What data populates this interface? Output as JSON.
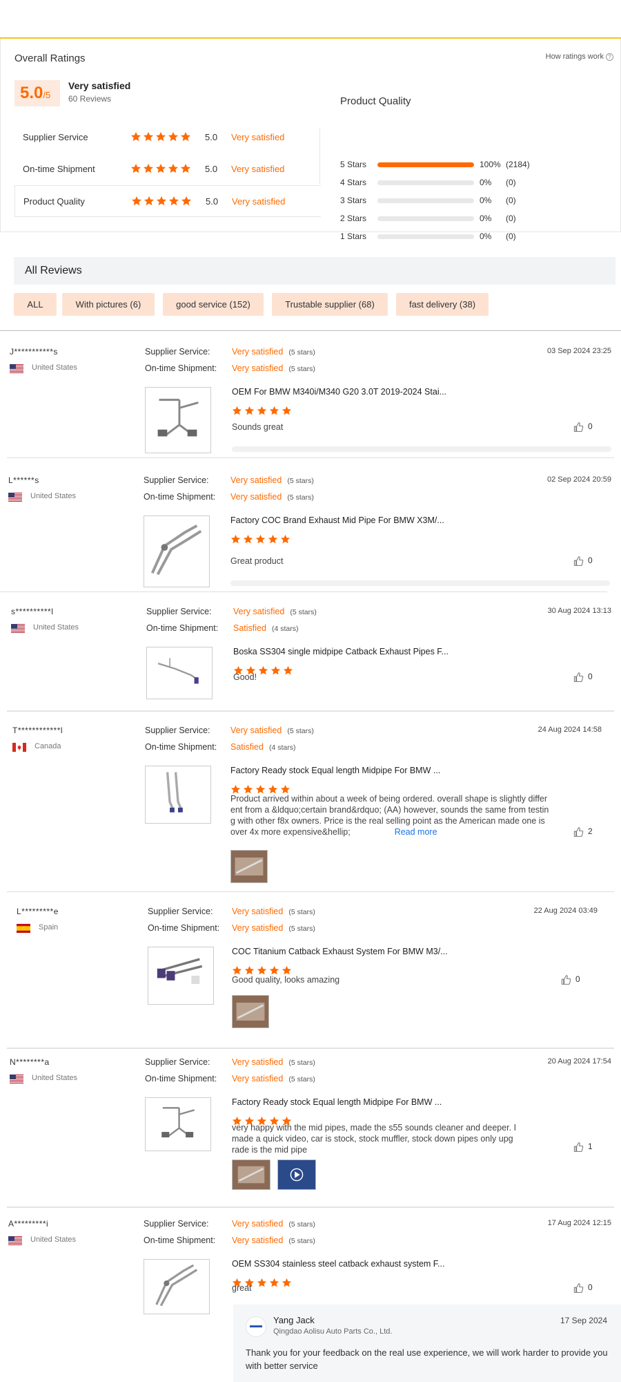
{
  "overall": {
    "title": "Overall Ratings",
    "how_link": "How ratings work",
    "score": "5.0",
    "score_max": "/5",
    "label": "Very satisfied",
    "reviews_count": "60 Reviews",
    "categories": [
      {
        "name": "Supplier Service",
        "stars": 5,
        "value": "5.0",
        "text": "Very satisfied"
      },
      {
        "name": "On-time Shipment",
        "stars": 5,
        "value": "5.0",
        "text": "Very satisfied"
      },
      {
        "name": "Product Quality",
        "stars": 5,
        "value": "5.0",
        "text": "Very satisfied"
      }
    ],
    "product_quality": {
      "title": "Product Quality",
      "rows": [
        {
          "label": "5  Stars",
          "fraction": 1.0,
          "pct": "100%",
          "count": "(2184)"
        },
        {
          "label": "4  Stars",
          "fraction": 0,
          "pct": "0%",
          "count": "(0)"
        },
        {
          "label": "3  Stars",
          "fraction": 0,
          "pct": "0%",
          "count": "(0)"
        },
        {
          "label": "2  Stars",
          "fraction": 0,
          "pct": "0%",
          "count": "(0)"
        },
        {
          "label": "1  Stars",
          "fraction": 0,
          "pct": "0%",
          "count": "(0)"
        }
      ]
    }
  },
  "all_reviews": {
    "title": "All Reviews",
    "filters": [
      "ALL",
      "With pictures (6)",
      "good service (152)",
      "Trustable supplier (68)",
      "fast delivery (38)"
    ]
  },
  "labels": {
    "supplier_service": "Supplier Service:",
    "ontime_shipment": "On-time Shipment:",
    "read_more": "Read more"
  },
  "colors": {
    "accent": "#ff6a00",
    "filter_bg": "#fde2d2",
    "top_line": "#f5c518"
  },
  "reviews": [
    {
      "name": "J***********s",
      "country": "United States",
      "flag": "us-flag-icon",
      "supplier": "Very satisfied",
      "supplier_stars": "(5 stars)",
      "shipment": "Very satisfied",
      "shipment_stars": "(5 stars)",
      "date": "03 Sep 2024 23:25",
      "product": "OEM For BMW M340i/M340 G20 3.0T 2019-2024 Stai...",
      "rating": 5,
      "text": "Sounds great",
      "likes": "0"
    },
    {
      "name": "L******s",
      "country": "United States",
      "flag": "us-flag-icon",
      "supplier": "Very satisfied",
      "supplier_stars": "(5 stars)",
      "shipment": "Very satisfied",
      "shipment_stars": "(5 stars)",
      "date": "02 Sep 2024 20:59",
      "product": "Factory COC Brand Exhaust Mid Pipe For BMW X3M/...",
      "rating": 5,
      "text": "Great product",
      "likes": "0"
    },
    {
      "name": "s**********l",
      "country": "United States",
      "flag": "us-flag-icon",
      "supplier": "Very satisfied",
      "supplier_stars": "(5 stars)",
      "shipment": "Satisfied",
      "shipment_stars": "(4 stars)",
      "date": "30 Aug 2024 13:13",
      "product": "Boska SS304 single midpipe Catback Exhaust Pipes F...",
      "rating": 5,
      "text": "Good!",
      "likes": "0"
    },
    {
      "name": "T************l",
      "country": "Canada",
      "flag": "canada-flag-icon",
      "supplier": "Very satisfied",
      "supplier_stars": "(5 stars)",
      "shipment": "Satisfied",
      "shipment_stars": "(4 stars)",
      "date": "24 Aug 2024 14:58",
      "product": "Factory Ready stock Equal length Midpipe For BMW ...",
      "rating": 5,
      "text_lines": [
        "Product arrived within about a week of being ordered. overall shape is slightly differ",
        "ent from a &ldquo;certain brand&rdquo; (AA) however, sounds the same from testin",
        "g with other f8x owners. Price is the real selling point as the American made one is",
        "over 4x more expensive&hellip;"
      ],
      "likes": "2"
    },
    {
      "name": "L*********e",
      "country": "Spain",
      "flag": "spain-flag-icon",
      "supplier": "Very satisfied",
      "supplier_stars": "(5 stars)",
      "shipment": "Very satisfied",
      "shipment_stars": "(5 stars)",
      "date": "22 Aug 2024 03:49",
      "product": "COC Titanium Catback Exhaust System For BMW M3/...",
      "rating": 5,
      "text": "Good quality, looks amazing",
      "likes": "0"
    },
    {
      "name": "N********a",
      "country": "United States",
      "flag": "us-flag-icon",
      "supplier": "Very satisfied",
      "supplier_stars": "(5 stars)",
      "shipment": "Very satisfied",
      "shipment_stars": "(5 stars)",
      "date": "20 Aug 2024 17:54",
      "product": "Factory Ready stock Equal length Midpipe For BMW ...",
      "rating": 5,
      "text_lines": [
        "very happy with the mid pipes, made the s55 sounds cleaner and deeper. I",
        "made a quick video, car is stock, stock muffler, stock down pipes only upg",
        "rade is the mid pipe"
      ],
      "likes": "1"
    },
    {
      "name": "A*********i",
      "country": "United States",
      "flag": "us-flag-icon",
      "supplier": "Very satisfied",
      "supplier_stars": "(5 stars)",
      "shipment": "Very satisfied",
      "shipment_stars": "(5 stars)",
      "date": "17 Aug 2024 12:15",
      "product": "OEM SS304 stainless steel catback exhaust system F...",
      "rating": 5,
      "text": "great",
      "likes": "0"
    }
  ],
  "reply": {
    "name": "Yang Jack",
    "company": "Qingdao Aolisu Auto Parts Co., Ltd.",
    "date": "17 Sep 2024",
    "message": "Thank you for your feedback on the real use experience, we will work harder to provide you with better service"
  }
}
